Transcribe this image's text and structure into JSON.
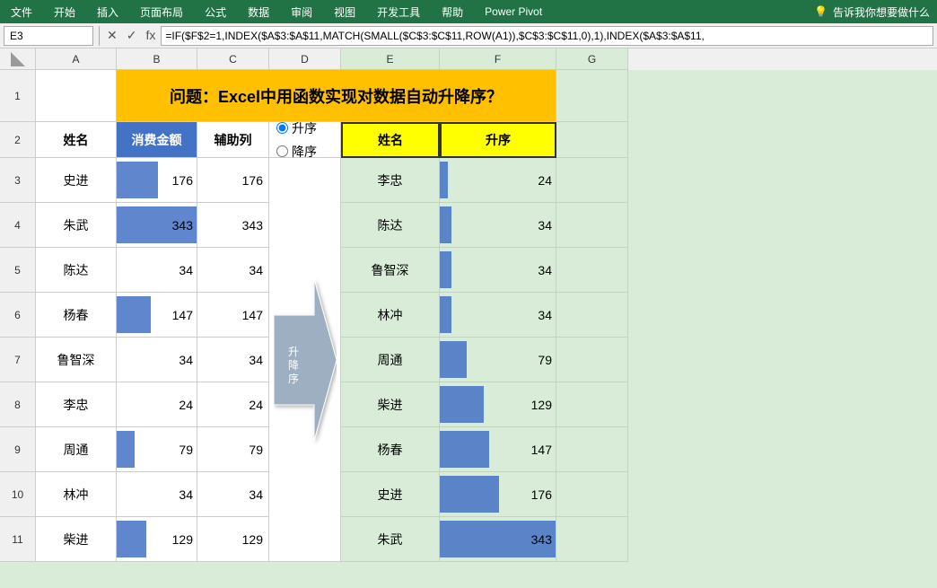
{
  "menubar": {
    "items": [
      "文件",
      "开始",
      "插入",
      "页面布局",
      "公式",
      "数据",
      "审阅",
      "视图",
      "开发工具",
      "帮助",
      "Power Pivot"
    ],
    "search_placeholder": "告诉我你想要做什么",
    "light_icon": "💡"
  },
  "formulabar": {
    "cell_ref": "E3",
    "cancel_icon": "✕",
    "confirm_icon": "✓",
    "fx_label": "fx",
    "formula": "=IF($F$2=1,INDEX($A$3:$A$11,MATCH(SMALL($C$3:$C$11,ROW(A1)),$C$3:$C$11,0),1),INDEX($A$3:$A$11,"
  },
  "spreadsheet": {
    "col_headers": [
      "A",
      "B",
      "C",
      "D",
      "E",
      "F",
      "G"
    ],
    "title": "问题：Excel中用函数实现对数据自动升降序？",
    "headers": {
      "name": "姓名",
      "amount": "消费金额",
      "helper": "辅助列",
      "sort_label": "升序",
      "result_name": "姓名",
      "result_sort": "升序"
    },
    "radio": {
      "ascending": "升序",
      "descending": "降序",
      "ascending_checked": true
    },
    "arrow_label": "升\n降\n序",
    "data_rows": [
      {
        "name": "史进",
        "amount": 176,
        "helper": 176,
        "has_bar_b": true
      },
      {
        "name": "朱武",
        "amount": 343,
        "helper": 343,
        "has_bar_b": true
      },
      {
        "name": "陈达",
        "amount": 34,
        "helper": 34,
        "has_bar_b": false
      },
      {
        "name": "杨春",
        "amount": 147,
        "helper": 147,
        "has_bar_b": true
      },
      {
        "name": "鲁智深",
        "amount": 34,
        "helper": 34,
        "has_bar_b": false
      },
      {
        "name": "李忠",
        "amount": 24,
        "helper": 24,
        "has_bar_b": false
      },
      {
        "name": "周通",
        "amount": 79,
        "helper": 79,
        "has_bar_b": true
      },
      {
        "name": "林冲",
        "amount": 34,
        "helper": 34,
        "has_bar_b": false
      },
      {
        "name": "柴进",
        "amount": 129,
        "helper": 129,
        "has_bar_b": true
      }
    ],
    "result_rows": [
      {
        "name": "李忠",
        "value": 24
      },
      {
        "name": "陈达",
        "value": 34
      },
      {
        "name": "鲁智深",
        "value": 34
      },
      {
        "name": "林冲",
        "value": 34
      },
      {
        "name": "周通",
        "value": 79
      },
      {
        "name": "柴进",
        "value": 129
      },
      {
        "name": "杨春",
        "value": 147
      },
      {
        "name": "史进",
        "value": 176
      },
      {
        "name": "朱武",
        "value": 343
      }
    ],
    "max_value": 343
  }
}
